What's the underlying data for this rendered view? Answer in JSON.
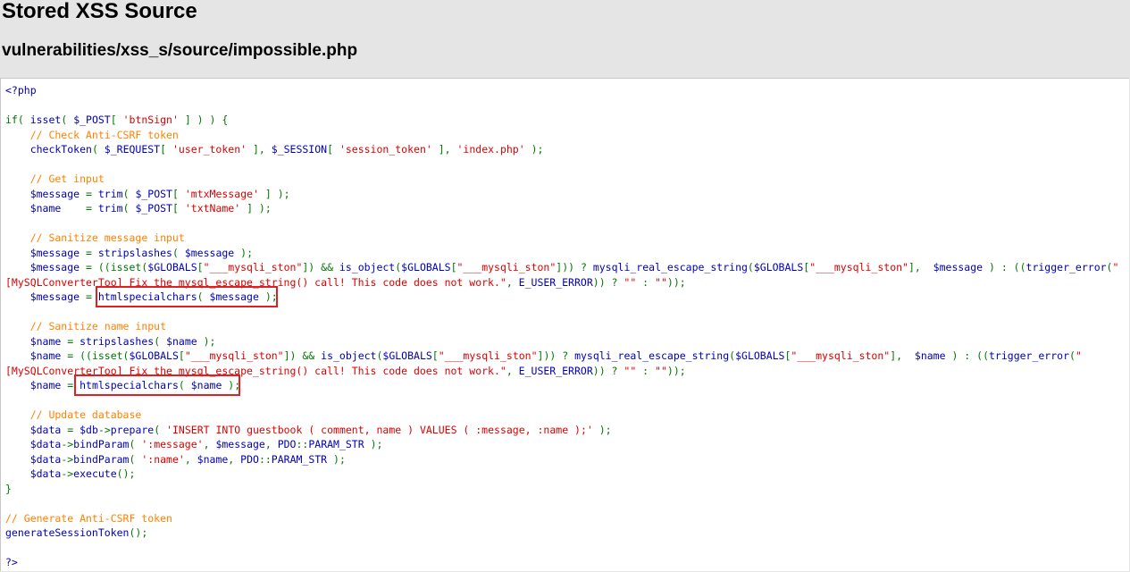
{
  "header": {
    "title": "Stored XSS Source",
    "path": "vulnerabilities/xss_s/source/impossible.php"
  },
  "colors": {
    "default": "#0000bb",
    "keyword": "#007700",
    "string": "#dd0000",
    "comment": "#ff8000",
    "highlight_box": "#e02020"
  },
  "code": {
    "lines": [
      [
        [
          "default",
          "<?php"
        ]
      ],
      [],
      [
        [
          "keyword",
          "if( "
        ],
        [
          "default",
          "isset"
        ],
        [
          "keyword",
          "( "
        ],
        [
          "default",
          "$_POST"
        ],
        [
          "keyword",
          "[ "
        ],
        [
          "string",
          "'btnSign'"
        ],
        [
          "keyword",
          " ] ) ) {"
        ]
      ],
      [
        [
          "comment",
          "    // Check Anti-CSRF token"
        ]
      ],
      [
        [
          "default",
          "    checkToken"
        ],
        [
          "keyword",
          "( "
        ],
        [
          "default",
          "$_REQUEST"
        ],
        [
          "keyword",
          "[ "
        ],
        [
          "string",
          "'user_token'"
        ],
        [
          "keyword",
          " ], "
        ],
        [
          "default",
          "$_SESSION"
        ],
        [
          "keyword",
          "[ "
        ],
        [
          "string",
          "'session_token'"
        ],
        [
          "keyword",
          " ], "
        ],
        [
          "string",
          "'index.php'"
        ],
        [
          "keyword",
          " );"
        ]
      ],
      [],
      [
        [
          "comment",
          "    // Get input"
        ]
      ],
      [
        [
          "default",
          "    $message "
        ],
        [
          "keyword",
          "= "
        ],
        [
          "default",
          "trim"
        ],
        [
          "keyword",
          "( "
        ],
        [
          "default",
          "$_POST"
        ],
        [
          "keyword",
          "[ "
        ],
        [
          "string",
          "'mtxMessage'"
        ],
        [
          "keyword",
          " ] );"
        ]
      ],
      [
        [
          "default",
          "    $name    "
        ],
        [
          "keyword",
          "= "
        ],
        [
          "default",
          "trim"
        ],
        [
          "keyword",
          "( "
        ],
        [
          "default",
          "$_POST"
        ],
        [
          "keyword",
          "[ "
        ],
        [
          "string",
          "'txtName'"
        ],
        [
          "keyword",
          " ] );"
        ]
      ],
      [],
      [
        [
          "comment",
          "    // Sanitize message input"
        ]
      ],
      [
        [
          "default",
          "    $message "
        ],
        [
          "keyword",
          "= "
        ],
        [
          "default",
          "stripslashes"
        ],
        [
          "keyword",
          "( "
        ],
        [
          "default",
          "$message "
        ],
        [
          "keyword",
          ");"
        ]
      ],
      [
        [
          "default",
          "    $message "
        ],
        [
          "keyword",
          "= ((isset("
        ],
        [
          "default",
          "$GLOBALS"
        ],
        [
          "keyword",
          "["
        ],
        [
          "string",
          "\"___mysqli_ston\""
        ],
        [
          "keyword",
          "]) && "
        ],
        [
          "default",
          "is_object"
        ],
        [
          "keyword",
          "("
        ],
        [
          "default",
          "$GLOBALS"
        ],
        [
          "keyword",
          "["
        ],
        [
          "string",
          "\"___mysqli_ston\""
        ],
        [
          "keyword",
          "])) ? "
        ],
        [
          "default",
          "mysqli_real_escape_string"
        ],
        [
          "keyword",
          "("
        ],
        [
          "default",
          "$GLOBALS"
        ],
        [
          "keyword",
          "["
        ],
        [
          "string",
          "\"___mysqli_ston\""
        ],
        [
          "keyword",
          "],  "
        ],
        [
          "default",
          "$message "
        ],
        [
          "keyword",
          ") : (("
        ],
        [
          "default",
          "trigger_error"
        ],
        [
          "keyword",
          "("
        ],
        [
          "string",
          "\""
        ]
      ],
      [
        [
          "string",
          "[MySQLConverterToo] Fix the mysql_escape_string() call! This code does not work.\""
        ],
        [
          "keyword",
          ", "
        ],
        [
          "default",
          "E_USER_ERROR"
        ],
        [
          "keyword",
          ")) ? "
        ],
        [
          "string",
          "\"\""
        ],
        [
          "keyword",
          " : "
        ],
        [
          "string",
          "\"\""
        ],
        [
          "keyword",
          "));"
        ]
      ],
      [
        [
          "default",
          "    $message "
        ],
        [
          "keyword",
          "= "
        ],
        [
          "default",
          "htmlspecialchars"
        ],
        [
          "keyword",
          "( "
        ],
        [
          "default",
          "$message "
        ],
        [
          "keyword",
          ");"
        ]
      ],
      [],
      [
        [
          "comment",
          "    // Sanitize name input"
        ]
      ],
      [
        [
          "default",
          "    $name "
        ],
        [
          "keyword",
          "= "
        ],
        [
          "default",
          "stripslashes"
        ],
        [
          "keyword",
          "( "
        ],
        [
          "default",
          "$name "
        ],
        [
          "keyword",
          ");"
        ]
      ],
      [
        [
          "default",
          "    $name "
        ],
        [
          "keyword",
          "= ((isset("
        ],
        [
          "default",
          "$GLOBALS"
        ],
        [
          "keyword",
          "["
        ],
        [
          "string",
          "\"___mysqli_ston\""
        ],
        [
          "keyword",
          "]) && "
        ],
        [
          "default",
          "is_object"
        ],
        [
          "keyword",
          "("
        ],
        [
          "default",
          "$GLOBALS"
        ],
        [
          "keyword",
          "["
        ],
        [
          "string",
          "\"___mysqli_ston\""
        ],
        [
          "keyword",
          "])) ? "
        ],
        [
          "default",
          "mysqli_real_escape_string"
        ],
        [
          "keyword",
          "("
        ],
        [
          "default",
          "$GLOBALS"
        ],
        [
          "keyword",
          "["
        ],
        [
          "string",
          "\"___mysqli_ston\""
        ],
        [
          "keyword",
          "],  "
        ],
        [
          "default",
          "$name "
        ],
        [
          "keyword",
          ") : (("
        ],
        [
          "default",
          "trigger_error"
        ],
        [
          "keyword",
          "("
        ],
        [
          "string",
          "\""
        ]
      ],
      [
        [
          "string",
          "[MySQLConverterToo] Fix the mysql_escape_string() call! This code does not work.\""
        ],
        [
          "keyword",
          ", "
        ],
        [
          "default",
          "E_USER_ERROR"
        ],
        [
          "keyword",
          ")) ? "
        ],
        [
          "string",
          "\"\""
        ],
        [
          "keyword",
          " : "
        ],
        [
          "string",
          "\"\""
        ],
        [
          "keyword",
          "));"
        ]
      ],
      [
        [
          "default",
          "    $name "
        ],
        [
          "keyword",
          "= "
        ],
        [
          "default",
          "htmlspecialchars"
        ],
        [
          "keyword",
          "( "
        ],
        [
          "default",
          "$name "
        ],
        [
          "keyword",
          ");"
        ]
      ],
      [],
      [
        [
          "comment",
          "    // Update database"
        ]
      ],
      [
        [
          "default",
          "    $data "
        ],
        [
          "keyword",
          "= "
        ],
        [
          "default",
          "$db"
        ],
        [
          "keyword",
          "->"
        ],
        [
          "default",
          "prepare"
        ],
        [
          "keyword",
          "( "
        ],
        [
          "string",
          "'INSERT INTO guestbook ( comment, name ) VALUES ( :message, :name );'"
        ],
        [
          "keyword",
          " );"
        ]
      ],
      [
        [
          "default",
          "    $data"
        ],
        [
          "keyword",
          "->"
        ],
        [
          "default",
          "bindParam"
        ],
        [
          "keyword",
          "( "
        ],
        [
          "string",
          "':message'"
        ],
        [
          "keyword",
          ", "
        ],
        [
          "default",
          "$message"
        ],
        [
          "keyword",
          ", "
        ],
        [
          "default",
          "PDO"
        ],
        [
          "keyword",
          "::"
        ],
        [
          "default",
          "PARAM_STR "
        ],
        [
          "keyword",
          ");"
        ]
      ],
      [
        [
          "default",
          "    $data"
        ],
        [
          "keyword",
          "->"
        ],
        [
          "default",
          "bindParam"
        ],
        [
          "keyword",
          "( "
        ],
        [
          "string",
          "':name'"
        ],
        [
          "keyword",
          ", "
        ],
        [
          "default",
          "$name"
        ],
        [
          "keyword",
          ", "
        ],
        [
          "default",
          "PDO"
        ],
        [
          "keyword",
          "::"
        ],
        [
          "default",
          "PARAM_STR "
        ],
        [
          "keyword",
          ");"
        ]
      ],
      [
        [
          "default",
          "    $data"
        ],
        [
          "keyword",
          "->"
        ],
        [
          "default",
          "execute"
        ],
        [
          "keyword",
          "();"
        ]
      ],
      [
        [
          "keyword",
          "}"
        ]
      ],
      [],
      [
        [
          "comment",
          "// Generate Anti-CSRF token"
        ]
      ],
      [
        [
          "default",
          "generateSessionToken"
        ],
        [
          "keyword",
          "();"
        ]
      ],
      [],
      [
        [
          "default",
          "?>"
        ]
      ]
    ]
  }
}
